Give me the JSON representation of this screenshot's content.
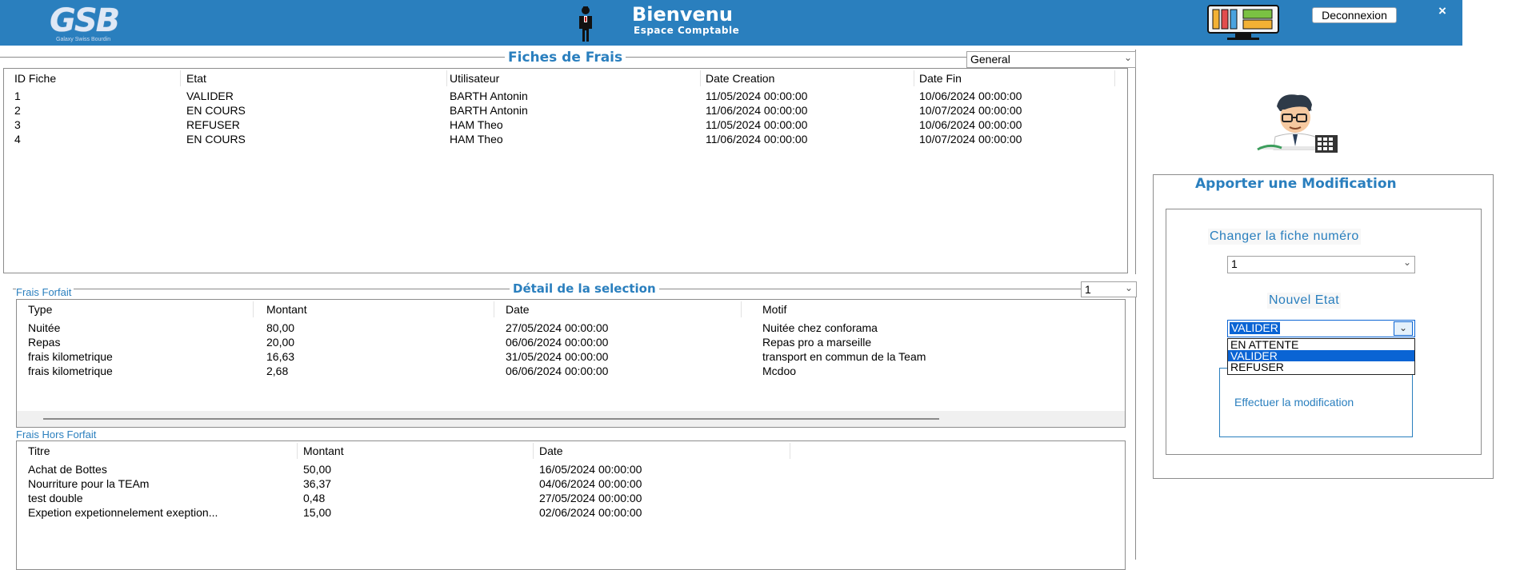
{
  "header": {
    "logo_text": "GSB",
    "logo_subtext": "Galaxy Swiss Bourdin",
    "welcome_title": "Bienvenu",
    "welcome_subtitle": "Espace Comptable",
    "logout_label": "Deconnexion",
    "close_label": "×"
  },
  "fiches": {
    "title": "Fiches de Frais",
    "filter_value": "General",
    "columns": [
      "ID Fiche",
      "Etat",
      "Utilisateur",
      "Date Creation",
      "Date Fin"
    ],
    "rows": [
      [
        "1",
        "VALIDER",
        "BARTH Antonin",
        "11/05/2024 00:00:00",
        "10/06/2024 00:00:00"
      ],
      [
        "2",
        "EN COURS",
        "BARTH Antonin",
        "11/06/2024 00:00:00",
        "10/07/2024 00:00:00"
      ],
      [
        "3",
        "REFUSER",
        "HAM Theo",
        "11/05/2024 00:00:00",
        "10/06/2024 00:00:00"
      ],
      [
        "4",
        "EN COURS",
        "HAM Theo",
        "11/06/2024 00:00:00",
        "10/07/2024 00:00:00"
      ]
    ]
  },
  "detail": {
    "title": "Détail de la selection",
    "selection_value": "1",
    "forfait_label": "Frais Forfait",
    "forfait_columns": [
      "Type",
      "Montant",
      "Date",
      "Motif"
    ],
    "forfait_rows": [
      [
        "Nuitée",
        "80,00",
        "27/05/2024 00:00:00",
        "Nuitée chez conforama"
      ],
      [
        "Repas",
        "20,00",
        "06/06/2024 00:00:00",
        "Repas pro a marseille"
      ],
      [
        "frais kilometrique",
        "16,63",
        "31/05/2024 00:00:00",
        "transport en commun de la Team"
      ],
      [
        "frais kilometrique",
        "2,68",
        "06/06/2024 00:00:00",
        "Mcdoo"
      ]
    ],
    "hors_forfait_label": "Frais Hors Forfait",
    "hors_forfait_columns": [
      "Titre",
      "Montant",
      "Date"
    ],
    "hors_forfait_rows": [
      [
        "Achat de Bottes",
        "50,00",
        "16/05/2024 00:00:00"
      ],
      [
        "Nourriture pour la TEAm",
        "36,37",
        "04/06/2024 00:00:00"
      ],
      [
        "test double",
        "0,48",
        "27/05/2024 00:00:00"
      ],
      [
        "Expetion expetionnelement exeption...",
        "15,00",
        "02/06/2024 00:00:00"
      ]
    ]
  },
  "modification": {
    "title": "Apporter une Modification",
    "change_label": "Changer la fiche numéro",
    "fiche_value": "1",
    "new_state_label": "Nouvel Etat",
    "state_value": "VALIDER",
    "state_options": [
      "EN ATTENTE",
      "VALIDER",
      "REFUSER"
    ],
    "selected_option": "VALIDER",
    "submit_label": "Effectuer la modification"
  },
  "colors": {
    "header": "#2a7fbe",
    "accent": "#2a7fbe",
    "selection": "#0a64d4"
  }
}
